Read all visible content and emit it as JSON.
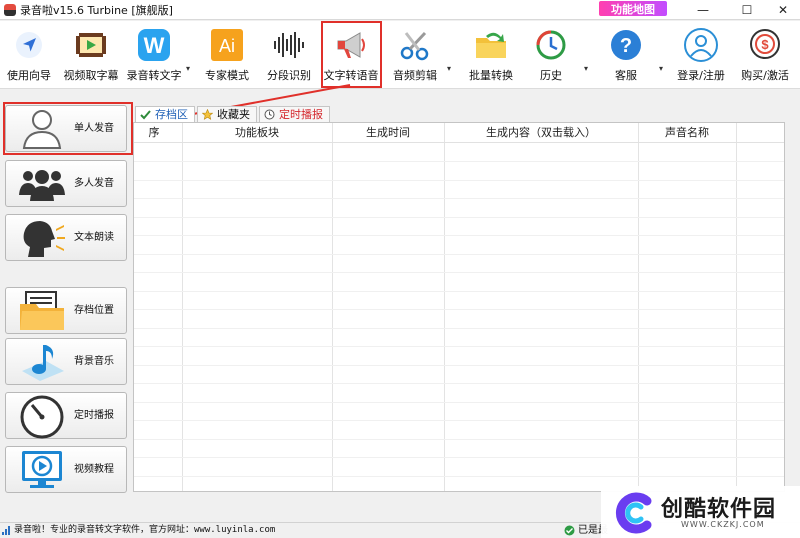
{
  "window": {
    "title": "录音啦v15.6 Turbine [旗舰版]",
    "function_map_label": "功能地图",
    "controls": {
      "minimize": "—",
      "maximize": "☐",
      "close": "✕"
    }
  },
  "toolbar": {
    "items": [
      {
        "label": "使用向导",
        "icon": "navigation-arrow-icon"
      },
      {
        "label": "视频取字幕",
        "icon": "video-film-icon"
      },
      {
        "label": "录音转文字",
        "icon": "w-badge-icon",
        "has_menu": true
      },
      {
        "label": "专家模式",
        "icon": "ai-badge-icon"
      },
      {
        "label": "分段识别",
        "icon": "waveform-icon"
      },
      {
        "label": "文字转语音",
        "icon": "megaphone-icon",
        "highlighted": true
      },
      {
        "label": "音频剪辑",
        "icon": "scissors-icon",
        "has_menu": true
      },
      {
        "label": "批量转换",
        "icon": "folder-arrow-icon"
      },
      {
        "label": "历史",
        "icon": "history-clock-icon",
        "has_menu": true
      },
      {
        "label": "客服",
        "icon": "help-question-icon",
        "has_menu": true
      },
      {
        "label": "登录/注册",
        "icon": "user-login-icon"
      },
      {
        "label": "购买/激活",
        "icon": "purchase-coin-icon"
      }
    ],
    "caret": "▾"
  },
  "sidebar": {
    "items": [
      {
        "label": "单人发音",
        "icon": "single-person-icon",
        "highlighted": true
      },
      {
        "label": "多人发音",
        "icon": "group-people-icon"
      },
      {
        "label": "文本朗读",
        "icon": "speaking-head-icon"
      },
      {
        "label": "存档位置",
        "icon": "archive-folder-icon"
      },
      {
        "label": "背景音乐",
        "icon": "music-note-icon"
      },
      {
        "label": "定时播报",
        "icon": "timer-dial-icon"
      },
      {
        "label": "视频教程",
        "icon": "video-play-icon"
      }
    ]
  },
  "tabs": [
    {
      "label": "存档区",
      "icon": "check-icon",
      "active": true
    },
    {
      "label": "收藏夹",
      "icon": "star-icon"
    },
    {
      "label": "定时播报",
      "icon": "clock-icon"
    }
  ],
  "table": {
    "columns": [
      "序",
      "功能板块",
      "生成时间",
      "生成内容（双击载入）",
      "声音名称"
    ],
    "rows": []
  },
  "statusbar": {
    "text": "录音啦！专业的录音转文字软件，官方网址：www.luyinla.com",
    "right_text": "已是最"
  },
  "watermark": {
    "title": "创酷软件园",
    "url": "WWW.CKZKJ.COM"
  },
  "colors": {
    "highlight": "#e0302a",
    "accent_blue": "#1d5fb6",
    "timer_red": "#d4282e"
  }
}
